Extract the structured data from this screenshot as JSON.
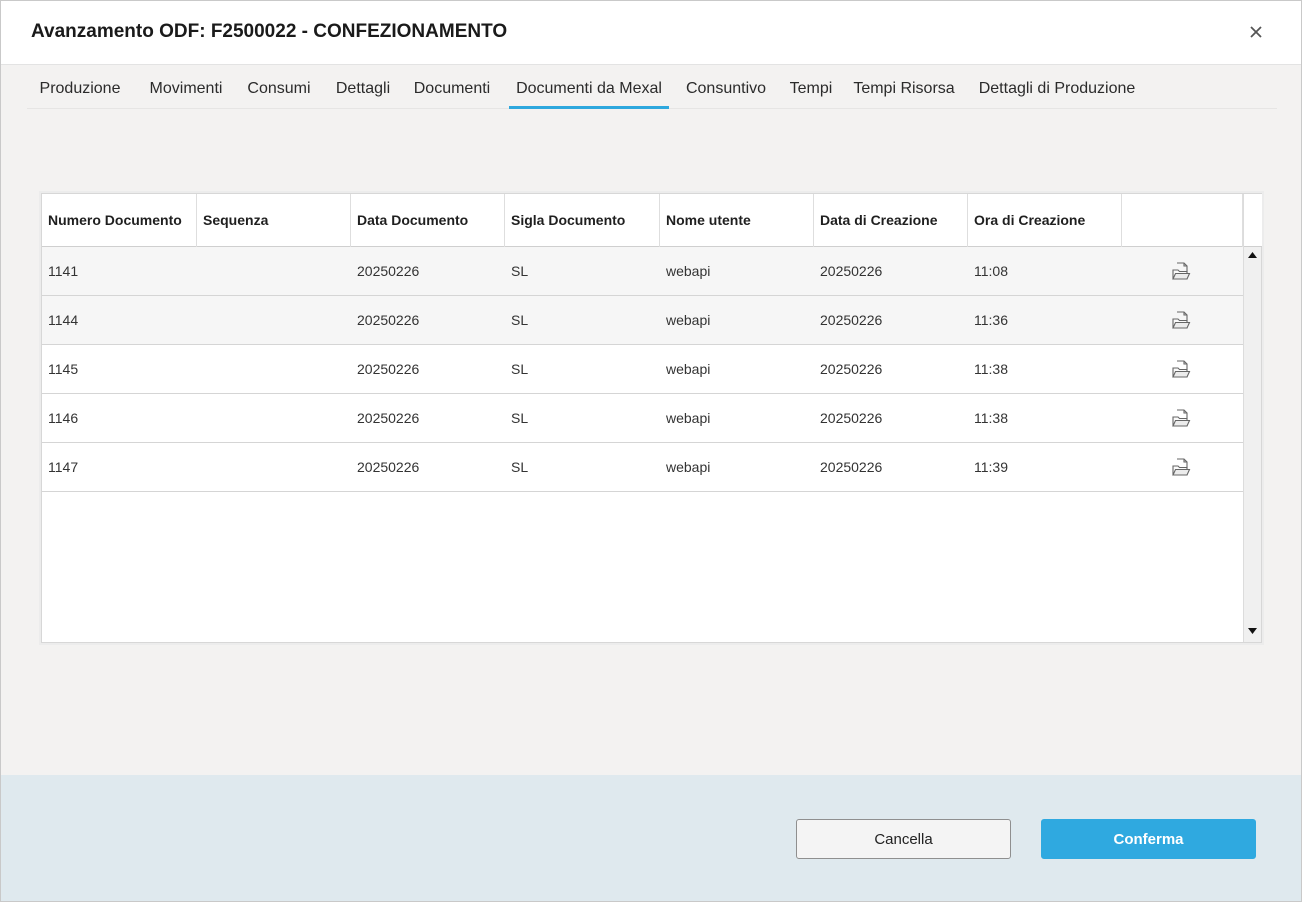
{
  "dialog": {
    "title": "Avanzamento ODF: F2500022 - CONFEZIONAMENTO",
    "close_icon": "close-icon"
  },
  "tabs": [
    {
      "label": "Produzione"
    },
    {
      "label": "Movimenti"
    },
    {
      "label": "Consumi"
    },
    {
      "label": "Dettagli"
    },
    {
      "label": "Documenti"
    },
    {
      "label": "Documenti da Mexal",
      "active": true
    },
    {
      "label": "Consuntivo"
    },
    {
      "label": "Tempi"
    },
    {
      "label": "Tempi Risorsa"
    },
    {
      "label": "Dettagli di Produzione"
    }
  ],
  "grid": {
    "columns": [
      "Numero Documento",
      "Sequenza",
      "Data Documento",
      "Sigla Documento",
      "Nome utente",
      "Data di Creazione",
      "Ora di Creazione",
      ""
    ],
    "rows": [
      {
        "numero": "1141",
        "sequenza": "",
        "data": "20250226",
        "sigla": "SL",
        "utente": "webapi",
        "data_creazione": "20250226",
        "ora": "11:08",
        "icon": "open-document-icon"
      },
      {
        "numero": "1144",
        "sequenza": "",
        "data": "20250226",
        "sigla": "SL",
        "utente": "webapi",
        "data_creazione": "20250226",
        "ora": "11:36",
        "icon": "open-document-icon"
      },
      {
        "numero": "1145",
        "sequenza": "",
        "data": "20250226",
        "sigla": "SL",
        "utente": "webapi",
        "data_creazione": "20250226",
        "ora": "11:38",
        "icon": "open-document-icon"
      },
      {
        "numero": "1146",
        "sequenza": "",
        "data": "20250226",
        "sigla": "SL",
        "utente": "webapi",
        "data_creazione": "20250226",
        "ora": "11:38",
        "icon": "open-document-icon"
      },
      {
        "numero": "1147",
        "sequenza": "",
        "data": "20250226",
        "sigla": "SL",
        "utente": "webapi",
        "data_creazione": "20250226",
        "ora": "11:39",
        "icon": "open-document-icon"
      }
    ]
  },
  "footer": {
    "cancel_label": "Cancella",
    "confirm_label": "Conferma"
  },
  "colors": {
    "accent": "#2ea8de",
    "footer_bg": "#dfe9ee",
    "content_bg": "#f3f2f1"
  }
}
